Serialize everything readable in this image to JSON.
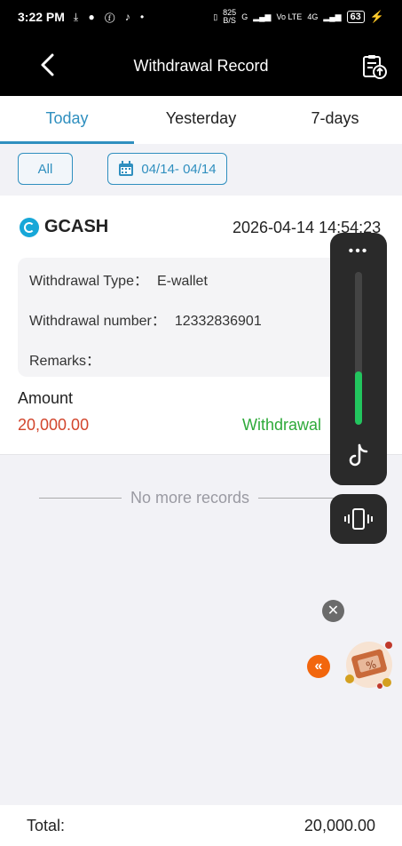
{
  "status_bar": {
    "time": "3:22 PM",
    "net_speed": "825",
    "net_unit": "B/S",
    "signal_text": "G",
    "volte": "Vo LTE",
    "network": "4G",
    "battery": "63"
  },
  "header": {
    "title": "Withdrawal Record"
  },
  "tabs": [
    {
      "label": "Today",
      "active": true
    },
    {
      "label": "Yesterday",
      "active": false
    },
    {
      "label": "7-days",
      "active": false
    }
  ],
  "filters": {
    "all_label": "All",
    "date_range": "04/14- 04/14"
  },
  "record": {
    "method": "GCASH",
    "datetime": "2026-04-14 14:54:23",
    "withdrawal_type_label": "Withdrawal Type：",
    "withdrawal_type_value": "E-wallet",
    "withdrawal_number_label": "Withdrawal number：",
    "withdrawal_number_value": "12332836901",
    "remarks_label": "Remarks：",
    "remarks_value": "",
    "amount_label": "Amount",
    "amount_value": "20,000.00",
    "status": "Withdrawal"
  },
  "no_more_text": "No more records",
  "overlay": {
    "dots": "•••",
    "volume_level": 0.35
  },
  "footer": {
    "total_label": "Total:",
    "total_value": "20,000.00"
  },
  "colors": {
    "accent": "#2f8fbf",
    "amount": "#d2452c",
    "status": "#2eaa3a"
  }
}
